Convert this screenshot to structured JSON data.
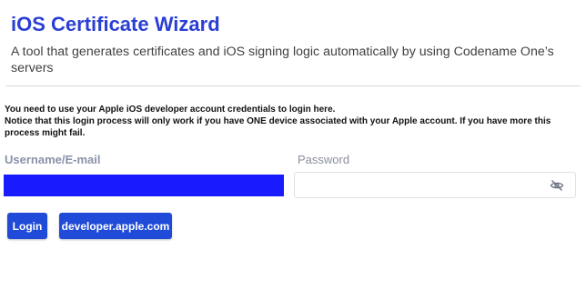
{
  "header": {
    "title": "iOS Certificate Wizard",
    "subtitle": "A tool that generates certificates and iOS signing logic automatically by using Codename One’s servers"
  },
  "notice": {
    "line1": "You need to use your Apple iOS developer account credentials to login here.",
    "line2": "Notice that this login process will only work if you have ONE device associated with your Apple account. If you have more this process might fail."
  },
  "form": {
    "username_label": "Username/E-mail",
    "username_value": "",
    "password_label": "Password",
    "password_value": "",
    "password_toggle_icon": "eye-slash-icon"
  },
  "actions": {
    "login_label": "Login",
    "developer_label": "developer.apple.com"
  },
  "colors": {
    "title": "#2a3fd4",
    "button": "#1f4bd8",
    "username_fill": "#1a1aff"
  }
}
